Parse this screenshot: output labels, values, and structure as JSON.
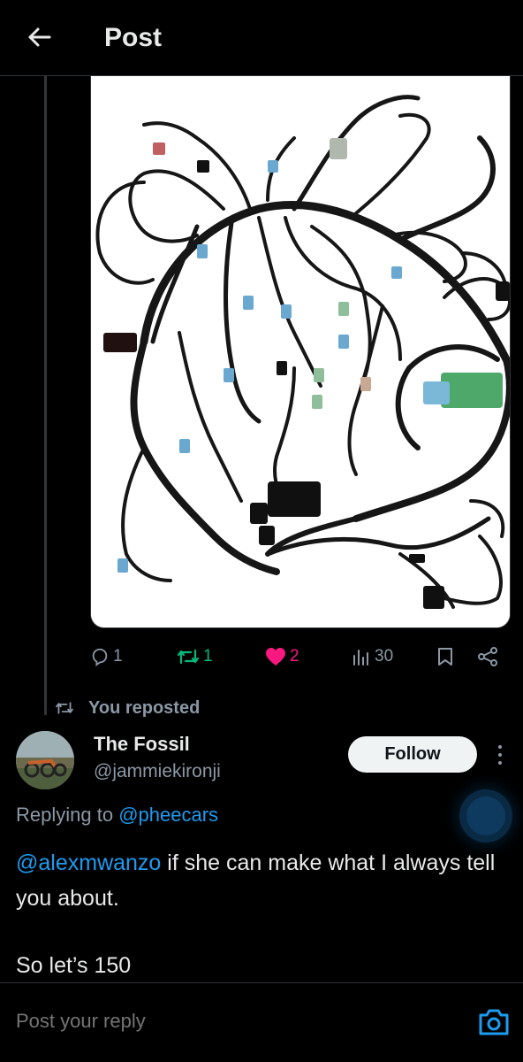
{
  "header": {
    "title": "Post",
    "back_icon": "arrow-left-icon"
  },
  "tweet_actions": {
    "replies": "1",
    "reposts": "1",
    "likes": "2",
    "views": "30"
  },
  "repost_note": "You reposted",
  "reply": {
    "user_name": "The Fossil",
    "user_handle": "@jammiekironji",
    "follow_label": "Follow",
    "replying_prefix": "Replying to",
    "replying_to": "@pheecars",
    "mention": "@alexmwanzo",
    "text_line1": " if she can make what I always tell you about.",
    "text_line2": "So let’s 150"
  },
  "composer": {
    "placeholder": "Post your reply"
  },
  "colors": {
    "background": "#000000",
    "accent": "#1d9bf0",
    "like": "#f91880",
    "repost": "#00ba7c",
    "muted": "#8b98a5"
  }
}
